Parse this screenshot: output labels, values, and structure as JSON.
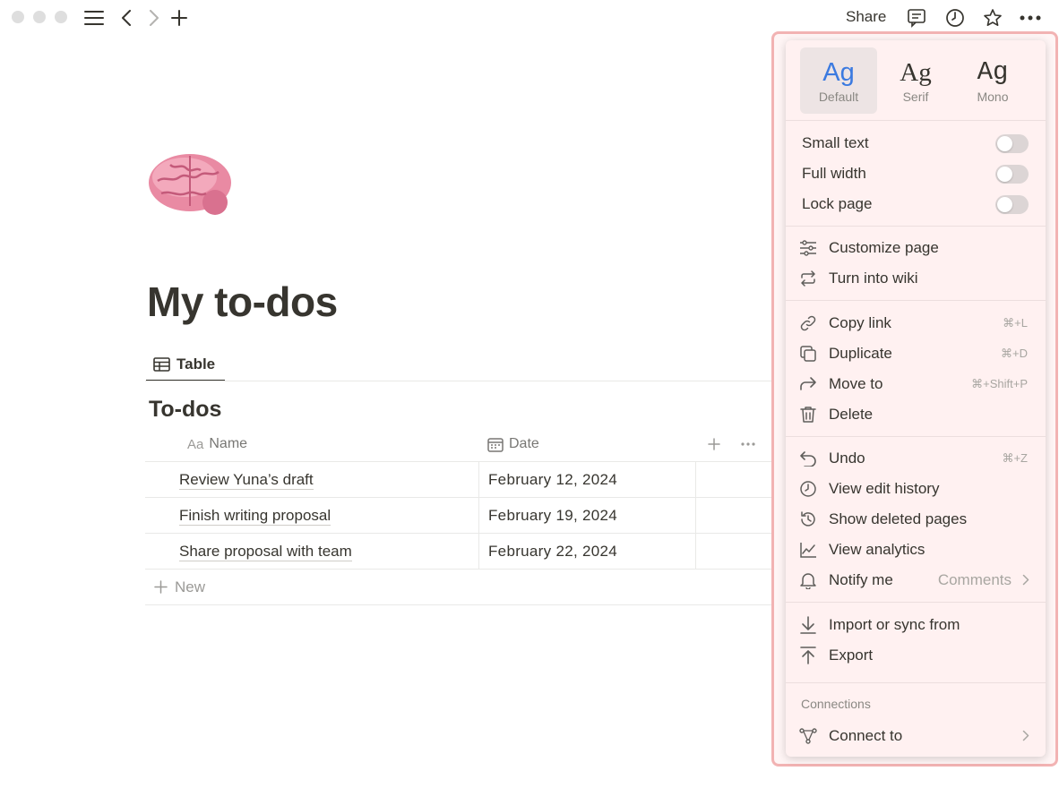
{
  "topbar": {
    "share_label": "Share",
    "icons": [
      "sidebar-menu-icon",
      "back-arrow-icon",
      "forward-arrow-icon",
      "plus-icon",
      "comment-icon",
      "clock-icon",
      "star-icon",
      "more-icon"
    ]
  },
  "page": {
    "emoji_icon": "brain-emoji-icon",
    "title": "My to-dos",
    "view_tab": "Table",
    "database_title": "To-dos"
  },
  "table": {
    "columns": [
      {
        "prefix": "Aa",
        "label": "Name"
      },
      {
        "label": "Date"
      }
    ],
    "rows": [
      {
        "name": "Review Yuna’s draft",
        "date": "February 12, 2024"
      },
      {
        "name": "Finish writing proposal",
        "date": "February 19, 2024"
      },
      {
        "name": "Share proposal with team",
        "date": "February 22, 2024"
      }
    ],
    "new_label": "New"
  },
  "menu": {
    "fonts": [
      {
        "glyph": "Ag",
        "label": "Default",
        "active": true
      },
      {
        "glyph": "Ag",
        "label": "Serif",
        "active": false
      },
      {
        "glyph": "Ag",
        "label": "Mono",
        "active": false
      }
    ],
    "toggles": [
      {
        "label": "Small text",
        "on": false
      },
      {
        "label": "Full width",
        "on": false
      },
      {
        "label": "Lock page",
        "on": false
      }
    ],
    "page_actions": [
      {
        "label": "Customize page",
        "icon": "sliders-icon"
      },
      {
        "label": "Turn into wiki",
        "icon": "repeat-icon"
      }
    ],
    "edit_actions": [
      {
        "label": "Copy link",
        "shortcut": "⌘+L",
        "icon": "link-icon"
      },
      {
        "label": "Duplicate",
        "shortcut": "⌘+D",
        "icon": "duplicate-icon"
      },
      {
        "label": "Move to",
        "shortcut": "⌘+Shift+P",
        "icon": "move-arrow-icon"
      },
      {
        "label": "Delete",
        "shortcut": "",
        "icon": "trash-icon"
      }
    ],
    "history_actions": [
      {
        "label": "Undo",
        "shortcut": "⌘+Z",
        "icon": "undo-icon"
      },
      {
        "label": "View edit history",
        "shortcut": "",
        "icon": "clock-icon"
      },
      {
        "label": "Show deleted pages",
        "shortcut": "",
        "icon": "restore-icon"
      },
      {
        "label": "View analytics",
        "shortcut": "",
        "icon": "chart-icon"
      },
      {
        "label": "Notify me",
        "value": "Comments",
        "icon": "bell-icon"
      }
    ],
    "io_actions": [
      {
        "label": "Import or sync from",
        "icon": "import-icon"
      },
      {
        "label": "Export",
        "icon": "export-icon"
      }
    ],
    "connections_label": "Connections",
    "connect_label": "Connect to"
  },
  "colors": {
    "accent": "#3b7ae0",
    "highlight_outline": "#f2b3b3",
    "menu_bg": "#fff1f1",
    "text": "#37352f"
  }
}
